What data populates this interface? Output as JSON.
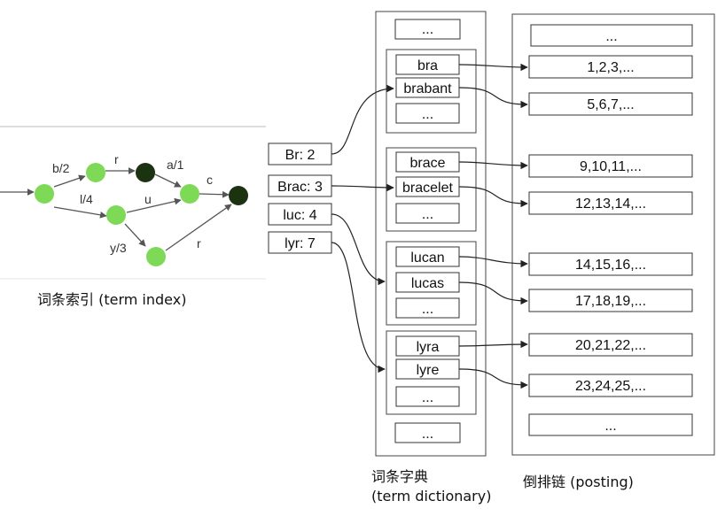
{
  "fst": {
    "edge_labels": [
      "b/2",
      "r",
      "a/1",
      "c",
      "l/4",
      "u",
      "y/3",
      "r"
    ]
  },
  "term_index": {
    "entries": [
      "Br: 2",
      "Brac: 3",
      "luc: 4",
      "lyr: 7"
    ]
  },
  "dictionary": {
    "top_ellipsis": "...",
    "bottom_ellipsis": "...",
    "blocks": [
      {
        "terms": [
          "bra",
          "brabant"
        ],
        "ellipsis": "..."
      },
      {
        "terms": [
          "brace",
          "bracelet"
        ],
        "ellipsis": "..."
      },
      {
        "terms": [
          "lucan",
          "lucas"
        ],
        "ellipsis": "..."
      },
      {
        "terms": [
          "lyra",
          "lyre"
        ],
        "ellipsis": "..."
      }
    ]
  },
  "postings": {
    "top_ellipsis": "...",
    "bottom_ellipsis": "...",
    "lists": [
      "1,2,3,...",
      "5,6,7,...",
      "9,10,11,...",
      "12,13,14,...",
      "14,15,16,...",
      "17,18,19,...",
      "20,21,22,...",
      "23,24,25,..."
    ]
  },
  "captions": {
    "term_index": "词条索引 (term index)",
    "term_dictionary_line1": "词条字典",
    "term_dictionary_line2": "(term dictionary)",
    "posting": "倒排链 (posting)"
  },
  "colors": {
    "node_green": "#7ED957",
    "node_dark": "#1B3311",
    "line": "#333333",
    "fst_edge": "#555555"
  }
}
